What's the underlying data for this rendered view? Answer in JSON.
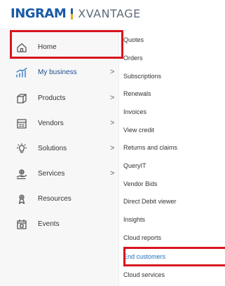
{
  "brand": {
    "logo_text": "INGRAM",
    "product_text": "XVANTAGE",
    "accent": "#1a5aa8",
    "highlight_color": "#d8141e"
  },
  "left_menu": [
    {
      "label": "Home",
      "icon": "home-icon",
      "has_submenu": false
    },
    {
      "label": "My business",
      "icon": "chart-icon",
      "has_submenu": true,
      "selected": true
    },
    {
      "label": "Products",
      "icon": "box-icon",
      "has_submenu": true
    },
    {
      "label": "Vendors",
      "icon": "building-icon",
      "has_submenu": true
    },
    {
      "label": "Solutions",
      "icon": "lightbulb-icon",
      "has_submenu": true
    },
    {
      "label": "Services",
      "icon": "services-icon",
      "has_submenu": true
    },
    {
      "label": "Resources",
      "icon": "resources-icon",
      "has_submenu": false
    },
    {
      "label": "Events",
      "icon": "calendar-icon",
      "has_submenu": false
    }
  ],
  "chevron": ">",
  "submenu": [
    {
      "label": "Quotes"
    },
    {
      "label": "Orders"
    },
    {
      "label": "Subscriptions"
    },
    {
      "label": "Renewals"
    },
    {
      "label": "Invoices"
    },
    {
      "label": "View credit"
    },
    {
      "label": "Returns and claims"
    },
    {
      "label": "QueryIT"
    },
    {
      "label": "Vendor Bids"
    },
    {
      "label": "Direct Debit viewer"
    },
    {
      "label": "Insights"
    },
    {
      "label": "Cloud reports"
    },
    {
      "label": "End customers",
      "selected": true
    },
    {
      "label": "Cloud services"
    }
  ]
}
